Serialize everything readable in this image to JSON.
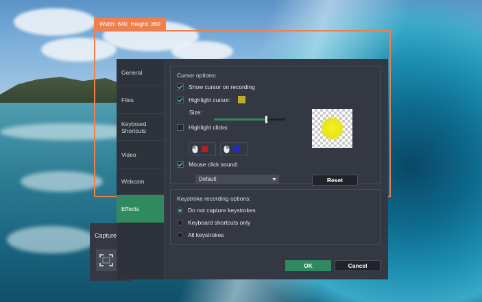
{
  "capture_frame": {
    "width_label": "Width: 640",
    "height_label": "Height: 360",
    "frame_color": "#f07f4e"
  },
  "capture_panel": {
    "label": "Capture",
    "icon": "capture-area-icon"
  },
  "sidebar": {
    "active_color": "#2f8a5f",
    "items": [
      {
        "label": "General",
        "active": false
      },
      {
        "label": "Files",
        "active": false
      },
      {
        "label": "Keyboard Shortcuts",
        "active": false
      },
      {
        "label": "Video",
        "active": false
      },
      {
        "label": "Webcam",
        "active": false
      },
      {
        "label": "Effects",
        "active": true
      }
    ]
  },
  "cursor_options": {
    "title": "Cursor options:",
    "show_cursor": {
      "label": "Show cursor on recording",
      "checked": true
    },
    "highlight_cursor": {
      "label": "Highlight cursor:",
      "checked": true,
      "color": "#b9ad2a"
    },
    "size": {
      "label": "Size:",
      "value_fraction": 0.73
    },
    "highlight_clicks": {
      "label": "Highlight clicks:",
      "checked": false,
      "left_click_color": "#b71f24",
      "right_click_color": "#1c2cc7"
    },
    "mouse_click_sound": {
      "label": "Mouse click sound:",
      "checked": true
    },
    "sound_select": {
      "value": "Default"
    },
    "reset_label": "Reset",
    "preview_color": "#f5f320"
  },
  "keystroke_options": {
    "title": "Keystroke recording options:",
    "options": [
      {
        "label": "Do not capture keystrokes",
        "selected": true
      },
      {
        "label": "Keyboard shortcuts only",
        "selected": false
      },
      {
        "label": "All keystrokes",
        "selected": false
      }
    ]
  },
  "footer": {
    "ok_label": "OK",
    "cancel_label": "Cancel"
  }
}
